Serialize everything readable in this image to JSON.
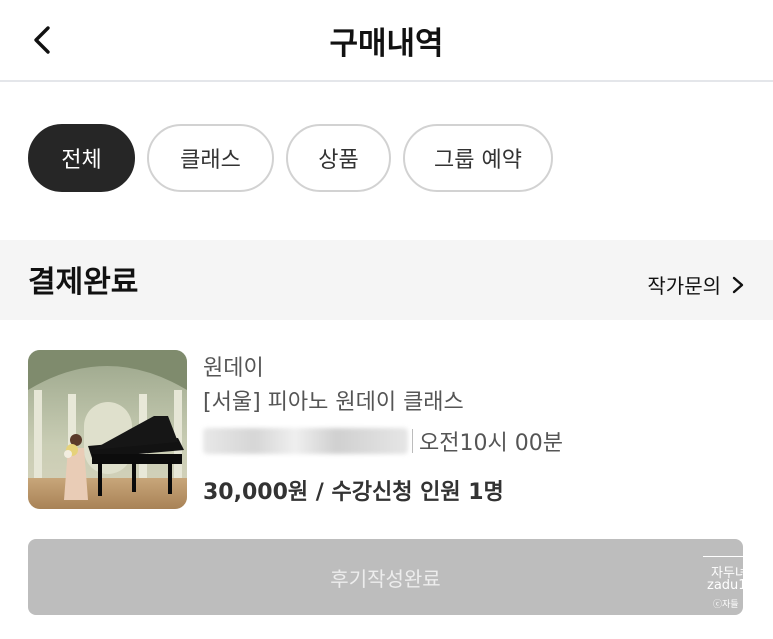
{
  "header": {
    "title": "구매내역",
    "back_icon": "chevron-left-icon"
  },
  "filters": {
    "selected": "전체",
    "chips": [
      {
        "label": "전체",
        "active": true
      },
      {
        "label": "클래스",
        "active": false
      },
      {
        "label": "상품",
        "active": false
      },
      {
        "label": "그룹 예약",
        "active": false
      }
    ]
  },
  "section": {
    "status": "결제완료",
    "inquiry_label": "작가문의",
    "inquiry_icon": "chevron-right-icon"
  },
  "order": {
    "thumbnail": "pianist-on-stage-photo",
    "category": "원데이",
    "class_name": "[서울]  피아노 원데이 클래스",
    "time": "오전10시 00분",
    "price_line": "30,000원 / 수강신청 인원 1명"
  },
  "review_button": {
    "label": "후기작성완료",
    "state": "disabled"
  },
  "watermark": {
    "line1": "자두녀",
    "line2": "zadu1",
    "line3": "ⓒ자들"
  },
  "colors": {
    "active_chip": "#262626",
    "section_bg": "#f5f5f5",
    "disabled_button": "#bdbdbd"
  }
}
